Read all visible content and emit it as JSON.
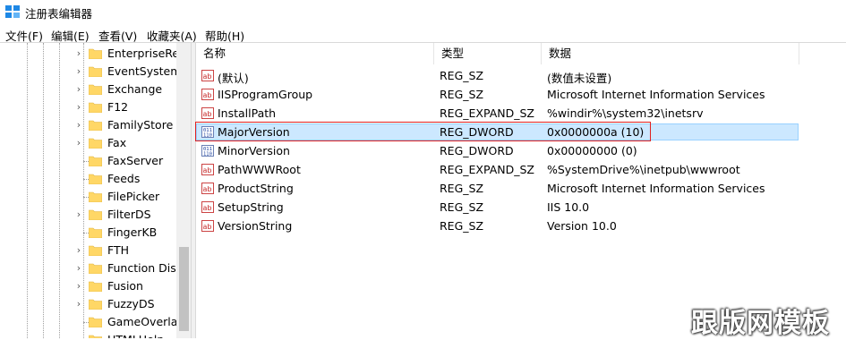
{
  "window": {
    "title": "注册表编辑器"
  },
  "menu": [
    "文件(F)",
    "编辑(E)",
    "查看(V)",
    "收藏夹(A)",
    "帮助(H)"
  ],
  "tree": {
    "items": [
      {
        "label": "EnterpriseRes",
        "expandable": true
      },
      {
        "label": "EventSystem",
        "expandable": true
      },
      {
        "label": "Exchange",
        "expandable": true
      },
      {
        "label": "F12",
        "expandable": true
      },
      {
        "label": "FamilyStore",
        "expandable": true
      },
      {
        "label": "Fax",
        "expandable": true
      },
      {
        "label": "FaxServer",
        "expandable": false
      },
      {
        "label": "Feeds",
        "expandable": false
      },
      {
        "label": "FilePicker",
        "expandable": false
      },
      {
        "label": "FilterDS",
        "expandable": true
      },
      {
        "label": "FingerKB",
        "expandable": false
      },
      {
        "label": "FTH",
        "expandable": true
      },
      {
        "label": "Function Disco",
        "expandable": true
      },
      {
        "label": "Fusion",
        "expandable": true
      },
      {
        "label": "FuzzyDS",
        "expandable": true
      },
      {
        "label": "GameOverlay",
        "expandable": false
      },
      {
        "label": "HTMLHelp",
        "expandable": false
      }
    ]
  },
  "list": {
    "columns": [
      "名称",
      "类型",
      "数据"
    ],
    "rows": [
      {
        "name": "(默认)",
        "type": "REG_SZ",
        "data": "(数值未设置)",
        "icon": "string-value-icon"
      },
      {
        "name": "IISProgramGroup",
        "type": "REG_SZ",
        "data": "Microsoft Internet Information Services",
        "icon": "string-value-icon"
      },
      {
        "name": "InstallPath",
        "type": "REG_EXPAND_SZ",
        "data": "%windir%\\system32\\inetsrv",
        "icon": "string-value-icon"
      },
      {
        "name": "MajorVersion",
        "type": "REG_DWORD",
        "data": "0x0000000a (10)",
        "icon": "binary-value-icon",
        "selected": true
      },
      {
        "name": "MinorVersion",
        "type": "REG_DWORD",
        "data": "0x00000000 (0)",
        "icon": "binary-value-icon"
      },
      {
        "name": "PathWWWRoot",
        "type": "REG_EXPAND_SZ",
        "data": "%SystemDrive%\\inetpub\\wwwroot",
        "icon": "string-value-icon"
      },
      {
        "name": "ProductString",
        "type": "REG_SZ",
        "data": "Microsoft Internet Information Services",
        "icon": "string-value-icon"
      },
      {
        "name": "SetupString",
        "type": "REG_SZ",
        "data": "IIS 10.0",
        "icon": "string-value-icon"
      },
      {
        "name": "VersionString",
        "type": "REG_SZ",
        "data": "Version 10.0",
        "icon": "string-value-icon"
      }
    ]
  },
  "watermark": "跟版网模板",
  "colors": {
    "selection": "#cce8ff",
    "highlight_border": "#e02020",
    "folder": "#ffd766"
  }
}
